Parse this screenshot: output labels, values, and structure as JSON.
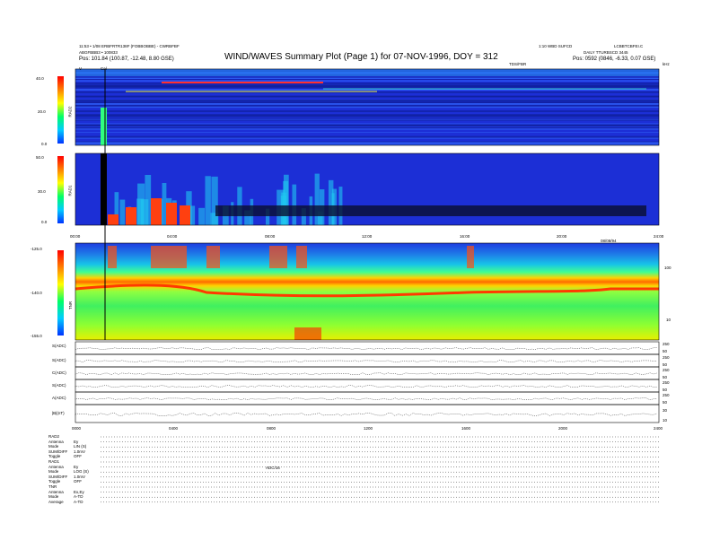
{
  "header": {
    "left_line1": "11:53 • 1/08 ERBFRTR138F (FOBBOBBE) - CWRBFBF",
    "left_line2": "ABGFBBB3 • 100833",
    "left_pos": "Pos: 101.84 (100.87, -12.48, 8.80 GSE)",
    "title": "WIND/WAVES Summary Plot (Page 1) for 07-NOV-1996, DOY = 312",
    "right_line1": "1:10 WBD SUFCD",
    "right_line1b": "LCBBTCBFEI.C",
    "right_line2": "DAILY TTURBSCD 3445",
    "right_pos": "Pos: 0592 (0846, -6.33, 0.07 GSE)",
    "right_small": "TDS/FBR",
    "right_corner": "kHz"
  },
  "top_axis": {
    "left_label": "V",
    "cal_label": "Cal"
  },
  "panels": {
    "rad2": {
      "label": "RAD2",
      "ticks": [
        "40.0",
        "20.0",
        "0.0"
      ]
    },
    "rad1": {
      "label": "RAD1",
      "ticks": [
        "50.0",
        "30.0",
        "0.0"
      ]
    },
    "tnr": {
      "label": "TNR",
      "ticks": [
        "-125.0",
        "-140.0",
        "-155.0"
      ],
      "right_ticks": [
        "100",
        "10"
      ]
    },
    "time_ticks": [
      "00:00",
      "04:00",
      "08:00",
      "12:00",
      "16:00",
      "20:00",
      "24:00"
    ],
    "time_note": "08/08/94"
  },
  "line_panels": [
    {
      "label": "S(ADC)",
      "right": [
        "250",
        "50"
      ]
    },
    {
      "label": "S(ADC)",
      "right": [
        "250",
        "50"
      ]
    },
    {
      "label": "C(ADC)",
      "right": [
        "250",
        "50"
      ]
    },
    {
      "label": "S(ADC)",
      "right": [
        "250",
        "50"
      ]
    },
    {
      "label": "A(ADC)",
      "right": [
        "250",
        "50"
      ]
    },
    {
      "label": "|B|(nT)",
      "right": [
        "30",
        "10"
      ]
    }
  ],
  "bottom_ticks": [
    "0000",
    "0400",
    "0800",
    "1200",
    "1600",
    "2000",
    "2400"
  ],
  "footer": [
    {
      "key": "RAD2",
      "val": ""
    },
    {
      "key": "Antenna",
      "val": "Ey"
    },
    {
      "key": "Mode",
      "val": "LIN (S)"
    },
    {
      "key": "SUM/DIFF",
      "val": "1.0mV"
    },
    {
      "key": "Toggle",
      "val": "OFF"
    },
    {
      "key": "RAD1",
      "val": ""
    },
    {
      "key": "Antenna",
      "val": "Ey"
    },
    {
      "key": "Mode",
      "val": "LOG (S)"
    },
    {
      "key": "SUM/DIFF",
      "val": "1.0mV"
    },
    {
      "key": "Toggle",
      "val": "OFF"
    },
    {
      "key": "TNR",
      "val": ""
    },
    {
      "key": "Antenna",
      "val": "Ex,Ey"
    },
    {
      "key": "Mode",
      "val": "A-TD"
    },
    {
      "key": "Average",
      "val": "A-TD"
    }
  ],
  "footer_note": "ADC/16",
  "colors": {
    "colorbar": [
      "#ff0000",
      "#ff8000",
      "#ffff00",
      "#00ff66",
      "#00ccff",
      "#0033ff"
    ],
    "bg_blue": "#1c2fd6"
  }
}
